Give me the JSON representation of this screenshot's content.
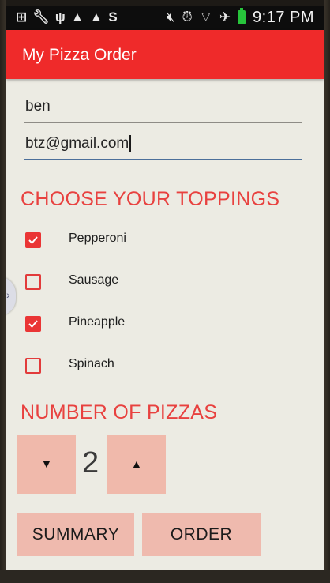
{
  "status_bar": {
    "left_icons": [
      "plus-box-icon",
      "wrench-icon",
      "usb-icon",
      "warning-icon",
      "warning-icon",
      "s-icon"
    ],
    "right_icons": [
      "mute-icon",
      "alarm-icon",
      "wifi-icon",
      "airplane-icon",
      "battery-icon"
    ],
    "time": "9:17 PM"
  },
  "app_bar": {
    "title": "My Pizza Order",
    "color": "#ef2a2a"
  },
  "form": {
    "name_value": "ben",
    "email_value": "btz@gmail.com"
  },
  "toppings": {
    "heading": "CHOOSE YOUR TOPPINGS",
    "items": [
      {
        "label": "Pepperoni",
        "checked": true
      },
      {
        "label": "Sausage",
        "checked": false
      },
      {
        "label": "Pineapple",
        "checked": true
      },
      {
        "label": "Spinach",
        "checked": false
      }
    ]
  },
  "quantity": {
    "heading": "NUMBER OF PIZZAS",
    "decrement_symbol": "▼",
    "increment_symbol": "▲",
    "value": "2"
  },
  "actions": {
    "summary_label": "SUMMARY",
    "order_label": "ORDER"
  },
  "colors": {
    "accent": "#e8413f",
    "button_bg": "#efbaae",
    "screen_bg": "#ecebe3"
  }
}
